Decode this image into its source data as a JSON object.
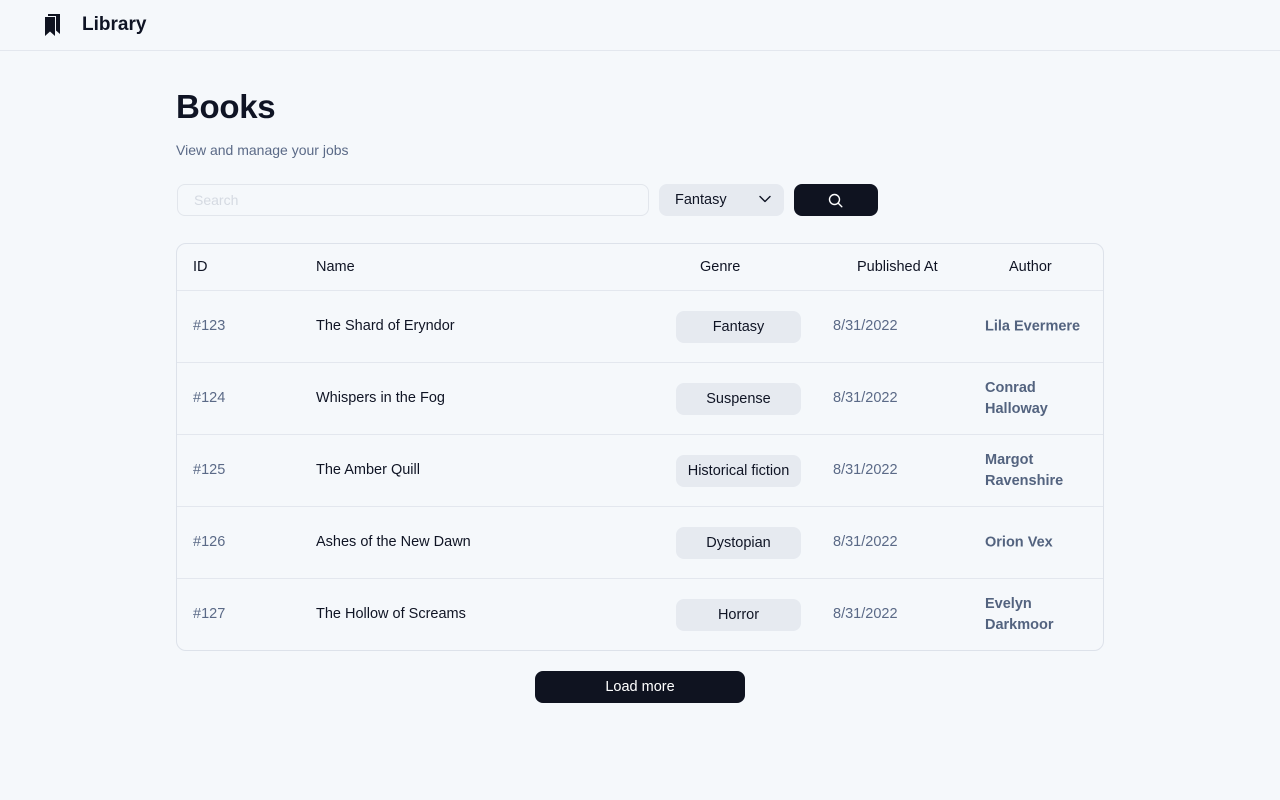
{
  "header": {
    "app_title": "Library",
    "logo_icon": "bookmarks-icon"
  },
  "main": {
    "title": "Books",
    "subtitle": "View and manage your jobs"
  },
  "filters": {
    "search_placeholder": "Search",
    "search_value": "",
    "genre_selected": "Fantasy",
    "search_button_icon": "search-icon"
  },
  "table": {
    "columns": {
      "id": "ID",
      "name": "Name",
      "genre": "Genre",
      "published_at": "Published At",
      "author": "Author"
    },
    "rows": [
      {
        "id": "#123",
        "name": "The Shard of Eryndor",
        "genre": "Fantasy",
        "published_at": "8/31/2022",
        "author": "Lila Evermere"
      },
      {
        "id": "#124",
        "name": "Whispers in the Fog",
        "genre": "Suspense",
        "published_at": "8/31/2022",
        "author": "Conrad Halloway"
      },
      {
        "id": "#125",
        "name": "The Amber Quill",
        "genre": "Historical fiction",
        "published_at": "8/31/2022",
        "author": "Margot Ravenshire"
      },
      {
        "id": "#126",
        "name": "Ashes of the New Dawn",
        "genre": "Dystopian",
        "published_at": "8/31/2022",
        "author": "Orion Vex"
      },
      {
        "id": "#127",
        "name": "The Hollow of Screams",
        "genre": "Horror",
        "published_at": "8/31/2022",
        "author": "Evelyn Darkmoor"
      }
    ]
  },
  "pagination": {
    "load_more_label": "Load more"
  },
  "colors": {
    "background": "#f5f8fb",
    "primary_button": "#0f1320",
    "muted_text": "#5b6a87",
    "chip_background": "#e6eaf0"
  }
}
